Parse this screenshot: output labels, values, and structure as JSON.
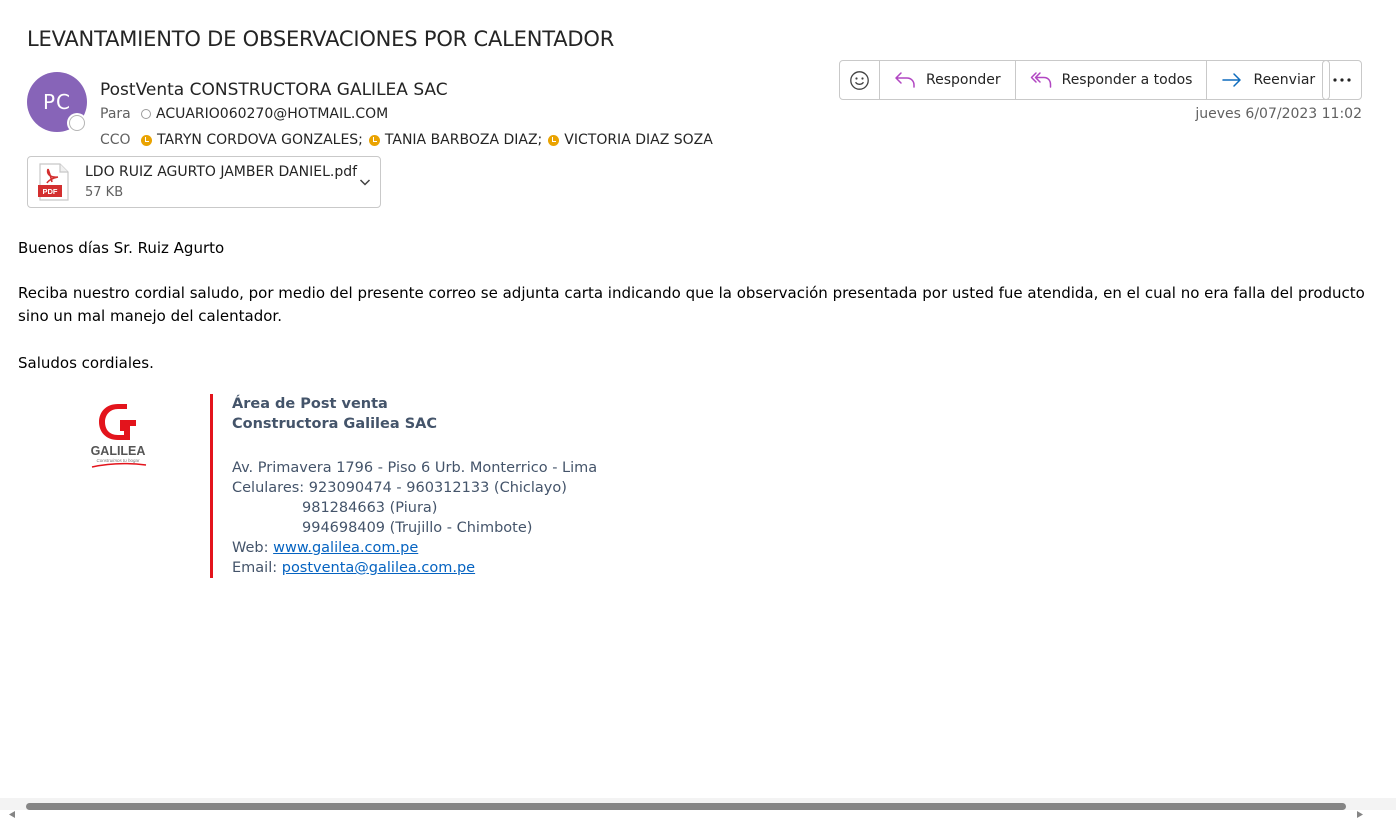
{
  "email": {
    "subject": "LEVANTAMIENTO DE OBSERVACIONES POR CALENTADOR",
    "avatar_initials": "PC",
    "sender": "PostVenta CONSTRUCTORA GALILEA SAC",
    "to_label": "Para",
    "to": [
      "ACUARIO060270@HOTMAIL.COM"
    ],
    "bcc_label": "CCO",
    "bcc": [
      "TARYN CORDOVA GONZALES;",
      "TANIA BARBOZA DIAZ;",
      "VICTORIA DIAZ SOZA"
    ],
    "datetime": "jueves 6/07/2023 11:02"
  },
  "attachment": {
    "name": "LDO RUIZ AGURTO JAMBER DANIEL.pdf",
    "size": "57 KB",
    "icon_label": "PDF"
  },
  "toolbar": {
    "emoji_icon": "smiley-icon",
    "reply_label": "Responder",
    "reply_all_label": "Responder a todos",
    "forward_label": "Reenviar",
    "more_icon": "more-icon"
  },
  "body": {
    "greeting": "Buenos días Sr. Ruiz Agurto",
    "paragraph_line1": "Reciba nuestro cordial saludo, por medio del presente correo se adjunta carta indicando que la observación presentada por usted fue atendida, en el cual no era falla del producto",
    "paragraph_line2": "sino un mal manejo del calentador.",
    "closing": "Saludos cordiales."
  },
  "signature": {
    "logo_text": "GALILEA",
    "logo_tagline": "Construimos tu hogar",
    "dept": "Área de Post venta",
    "company": "Constructora Galilea SAC",
    "address": "Av. Primavera 1796 - Piso 6 Urb. Monterrico - Lima",
    "phones_label": "Celulares:",
    "phone1": "923090474 - 960312133 (Chiclayo)",
    "phone2": "981284663 (Piura)",
    "phone3": "994698409 (Trujillo - Chimbote)",
    "web_label": "Web:",
    "web": "www.galilea.com.pe",
    "email_label": "Email:",
    "email": "postventa@galilea.com.pe"
  },
  "colors": {
    "avatar": "#8764b8",
    "accent_reply": "#b146c2",
    "accent_forward": "#0f6cbd",
    "signature_bar": "#e3141c",
    "link": "#0563c1"
  }
}
